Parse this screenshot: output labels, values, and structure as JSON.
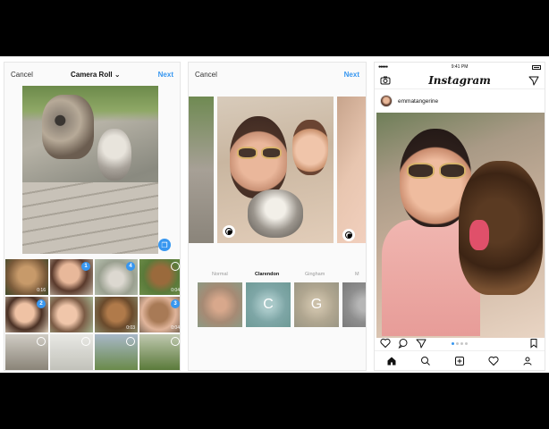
{
  "screen1": {
    "nav": {
      "left": "Cancel",
      "title": "Camera Roll",
      "right": "Next"
    },
    "selection_numbers": [
      "1",
      "2",
      "3",
      "4"
    ],
    "durations": [
      "0:16",
      "0:04",
      "0:03",
      "0:04"
    ]
  },
  "screen2": {
    "nav": {
      "left": "Cancel",
      "right": "Next"
    },
    "filters": [
      "Normal",
      "Clarendon",
      "Gingham",
      "M"
    ],
    "tile_letters": [
      "C",
      "G"
    ]
  },
  "screen3": {
    "status_time": "9:41 PM",
    "logo": "Instagram",
    "username": "emmatangerine"
  },
  "colors": {
    "accent": "#3897f0"
  }
}
